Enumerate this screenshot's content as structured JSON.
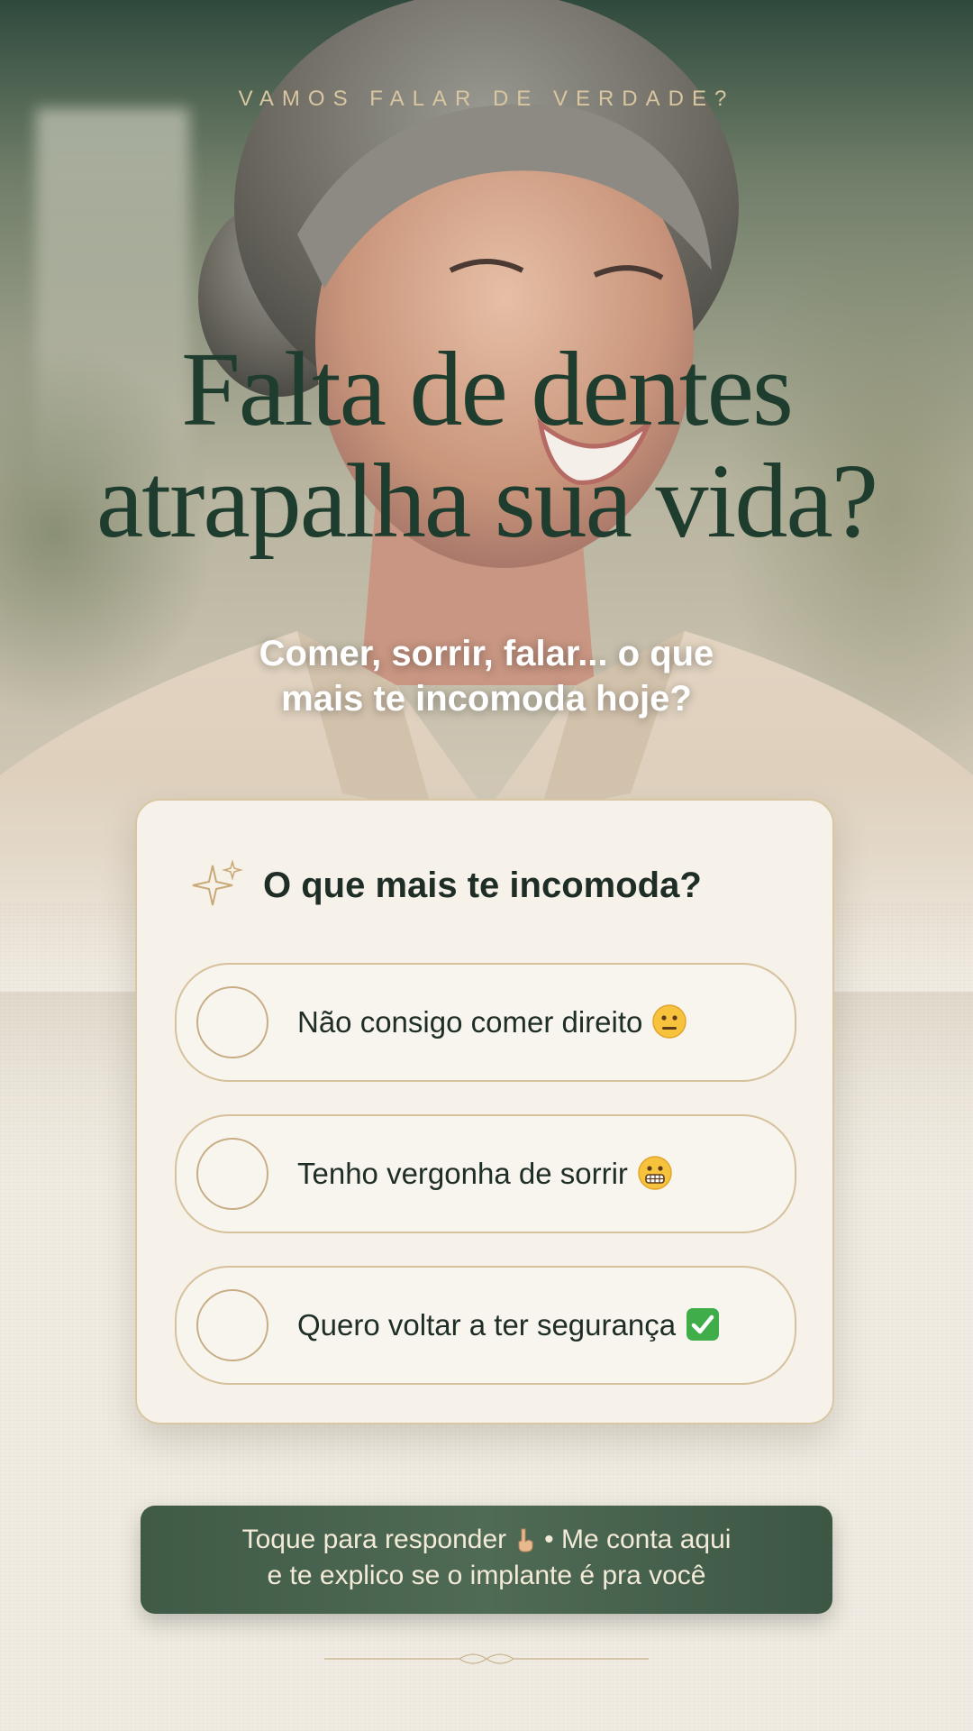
{
  "story": {
    "eyebrow": "VAMOS FALAR DE VERDADE?",
    "headline_line1": "Falta de dentes",
    "headline_line2": "atrapalha sua vida?",
    "subtitle_line1": "Comer, sorrir, falar... o que",
    "subtitle_line2": "mais te incomoda hoje?"
  },
  "poll": {
    "question": "O que mais te incomoda?",
    "question_icon": "sparkle-icon",
    "options": [
      {
        "label": "Não consigo comer direito",
        "emoji": "neutral-face-emoji"
      },
      {
        "label": "Tenho vergonha de sorrir",
        "emoji": "grimacing-face-emoji"
      },
      {
        "label": "Quero voltar a ter segurança",
        "emoji": "check-mark-button-emoji"
      }
    ]
  },
  "cta": {
    "line1_start": "Toque para responder",
    "line1_icon": "pointing-down-hand-icon",
    "line1_end": "• Me conta aqui",
    "line2": "e te explico se o implante é pra você"
  },
  "colors": {
    "headline": "#1f3d2e",
    "eyebrow": "#d8c6a0",
    "card_border": "#d9c7a4",
    "cta_bg": "#4f6a55"
  }
}
